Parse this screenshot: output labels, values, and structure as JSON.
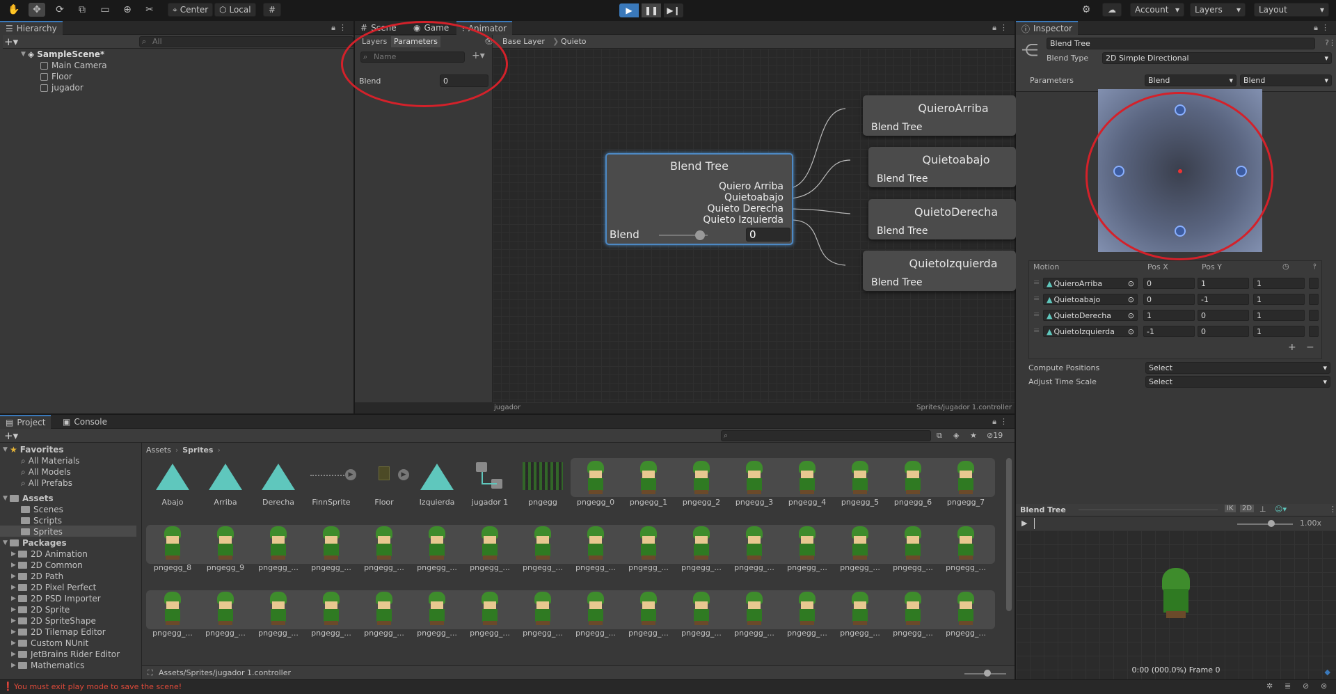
{
  "toolbar": {
    "pivot": "Center",
    "space": "Local",
    "account": "Account",
    "layers": "Layers",
    "layout": "Layout"
  },
  "hierarchy": {
    "tab": "Hierarchy",
    "search_placeholder": "All",
    "scene": "SampleScene*",
    "items": [
      "Main Camera",
      "Floor",
      "jugador"
    ]
  },
  "animator": {
    "tabs": [
      "Scene",
      "Game",
      "Animator"
    ],
    "left_tabs": [
      "Layers",
      "Parameters"
    ],
    "name_placeholder": "Name",
    "param_name": "Blend",
    "param_value": "0",
    "breadcrumb": [
      "Base Layer",
      "Quieto"
    ],
    "footer_left": "jugador",
    "footer_right": "Sprites/jugador 1.controller",
    "blend_node": {
      "title": "Blend Tree",
      "outputs": [
        "Quiero Arriba",
        "Quietoabajo",
        "Quieto Derecha",
        "Quieto Izquierda"
      ],
      "param": "Blend",
      "value": "0"
    },
    "targets": [
      {
        "title": "QuieroArriba",
        "sub": "Blend Tree"
      },
      {
        "title": "Quietoabajo",
        "sub": "Blend Tree"
      },
      {
        "title": "QuietoDerecha",
        "sub": "Blend Tree"
      },
      {
        "title": "QuietoIzquierda",
        "sub": "Blend Tree"
      }
    ]
  },
  "inspector": {
    "tab": "Inspector",
    "name": "Blend Tree",
    "blend_type_label": "Blend Type",
    "blend_type": "2D Simple Directional",
    "parameters_label": "Parameters",
    "param_x": "Blend",
    "param_y": "Blend",
    "motion_headers": [
      "Motion",
      "Pos X",
      "Pos Y"
    ],
    "motions": [
      {
        "name": "QuieroArriba",
        "x": "0",
        "y": "1",
        "speed": "1"
      },
      {
        "name": "Quietoabajo",
        "x": "0",
        "y": "-1",
        "speed": "1"
      },
      {
        "name": "QuietoDerecha",
        "x": "1",
        "y": "0",
        "speed": "1"
      },
      {
        "name": "QuietoIzquierda",
        "x": "-1",
        "y": "0",
        "speed": "1"
      }
    ],
    "compute_positions_label": "Compute Positions",
    "compute_positions": "Select",
    "adjust_time_label": "Adjust Time Scale",
    "adjust_time": "Select",
    "preview_title": "Blend Tree",
    "preview_speed": "1.00x",
    "preview_time": "0:00 (000.0%) Frame 0",
    "preview_buttons": [
      "IK",
      "2D"
    ]
  },
  "project": {
    "tabs": [
      "Project",
      "Console"
    ],
    "favorites_label": "Favorites",
    "favorites": [
      "All Materials",
      "All Models",
      "All Prefabs"
    ],
    "assets_label": "Assets",
    "asset_folders": [
      "Scenes",
      "Scripts",
      "Sprites"
    ],
    "packages_label": "Packages",
    "packages": [
      "2D Animation",
      "2D Common",
      "2D Path",
      "2D Pixel Perfect",
      "2D PSD Importer",
      "2D Sprite",
      "2D SpriteShape",
      "2D Tilemap Editor",
      "Custom NUnit",
      "JetBrains Rider Editor",
      "Mathematics"
    ],
    "breadcrumb": [
      "Assets",
      "Sprites"
    ],
    "hidden_count": "19",
    "row1": [
      "Abajo",
      "Arriba",
      "Derecha",
      "FinnSprite",
      "Floor",
      "Izquierda",
      "jugador 1",
      "pngegg",
      "pngegg_0",
      "pngegg_1",
      "pngegg_2",
      "pngegg_3",
      "pngegg_4",
      "pngegg_5",
      "pngegg_6",
      "pngegg_7"
    ],
    "row2": [
      "pngegg_8",
      "pngegg_9",
      "pngegg_...",
      "pngegg_...",
      "pngegg_...",
      "pngegg_...",
      "pngegg_...",
      "pngegg_...",
      "pngegg_...",
      "pngegg_...",
      "pngegg_...",
      "pngegg_...",
      "pngegg_...",
      "pngegg_...",
      "pngegg_...",
      "pngegg_..."
    ],
    "row3": [
      "pngegg_...",
      "pngegg_...",
      "pngegg_...",
      "pngegg_...",
      "pngegg_...",
      "pngegg_...",
      "pngegg_...",
      "pngegg_...",
      "pngegg_...",
      "pngegg_...",
      "pngegg_...",
      "pngegg_...",
      "pngegg_...",
      "pngegg_...",
      "pngegg_...",
      "pngegg_..."
    ],
    "footer_path": "Assets/Sprites/jugador 1.controller"
  },
  "status": {
    "message": "You must exit play mode to save the scene!"
  }
}
